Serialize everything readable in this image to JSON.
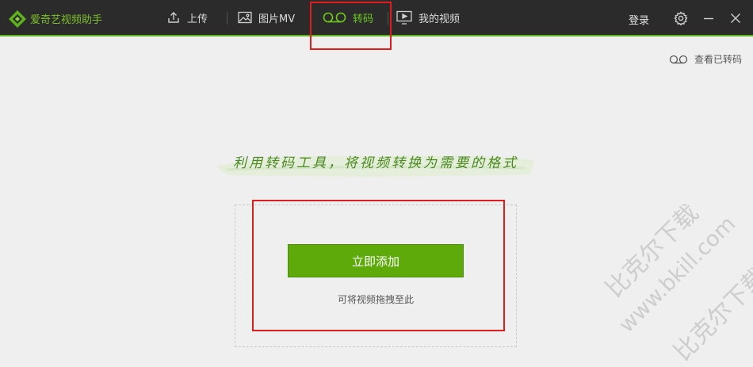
{
  "app": {
    "title": "爱奇艺视频助手"
  },
  "nav": {
    "items": [
      {
        "id": "upload",
        "label": "上传"
      },
      {
        "id": "photo-mv",
        "label": "图片MV"
      },
      {
        "id": "transcode",
        "label": "转码",
        "active": true
      },
      {
        "id": "my-videos",
        "label": "我的视频"
      }
    ]
  },
  "header": {
    "login_label": "登录"
  },
  "toolbar": {
    "view_converted_label": "查看已转码"
  },
  "main": {
    "slogan": "利用转码工具，将视频转换为需要的格式",
    "add_button_label": "立即添加",
    "drag_hint": "可将视频拖拽至此"
  },
  "watermark": {
    "line1": "比克尔下载",
    "line2": "www.bkill.com",
    "line3": "比克尔下载"
  },
  "colors": {
    "accent": "#5eaa0b",
    "titlebar_bg": "#2b2b2b",
    "active_nav": "#6ecb1e",
    "highlight_box": "#e01c1c"
  }
}
